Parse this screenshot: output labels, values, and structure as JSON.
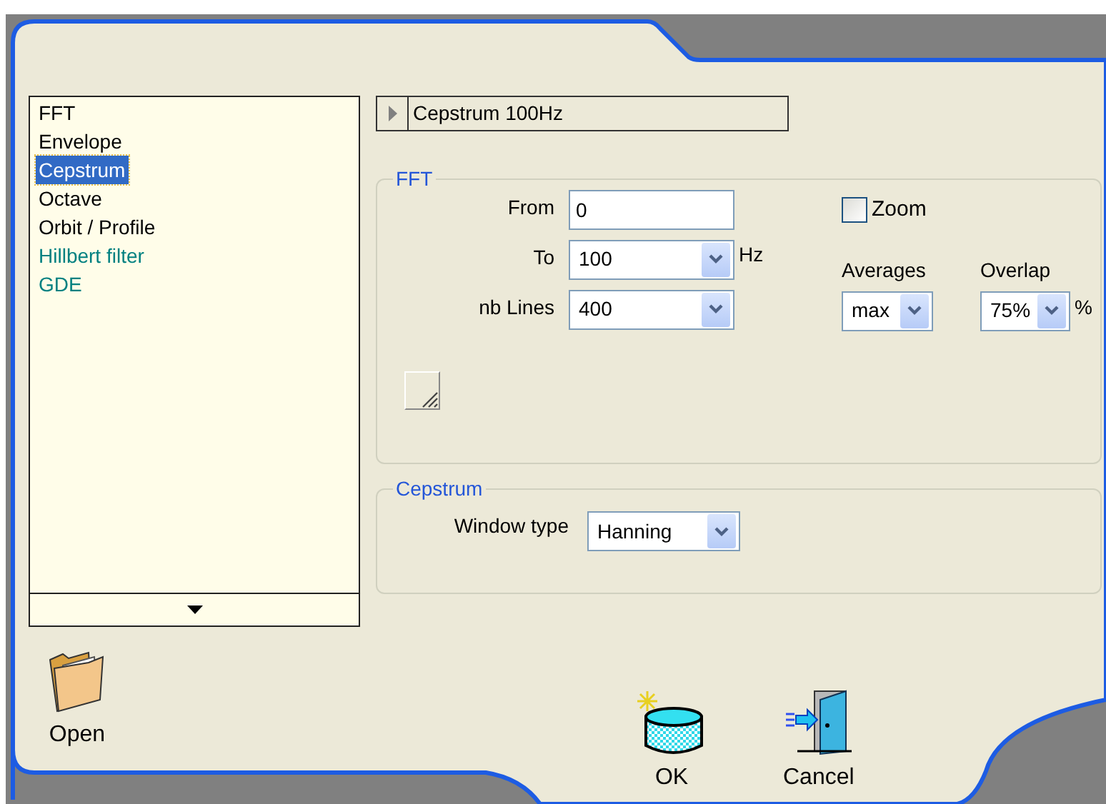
{
  "list": {
    "items": [
      {
        "label": "FFT",
        "selected": false,
        "color": "#000000"
      },
      {
        "label": "Envelope",
        "selected": false,
        "color": "#000000"
      },
      {
        "label": "Cepstrum",
        "selected": true
      },
      {
        "label": "Octave",
        "selected": false,
        "color": "#000000"
      },
      {
        "label": "Orbit / Profile",
        "selected": false,
        "color": "#000000"
      },
      {
        "label": "Hillbert filter",
        "selected": false,
        "color": "#008080"
      },
      {
        "label": "GDE",
        "selected": false,
        "color": "#008080"
      }
    ]
  },
  "header": {
    "title": "Cepstrum 100Hz",
    "expanded": false
  },
  "fft": {
    "title": "FFT",
    "fields": [
      {
        "label": "From",
        "kind": "text",
        "value": "0"
      },
      {
        "label": "To",
        "kind": "combo",
        "value": "100",
        "unit": "Hz"
      },
      {
        "label": "nb Lines",
        "kind": "combo",
        "value": "400"
      }
    ],
    "zoom": {
      "label": "Zoom",
      "checked": false
    },
    "averages": {
      "label": "Averages",
      "value": "max"
    },
    "overlap": {
      "label": "Overlap",
      "value": "75%",
      "unit": "%"
    }
  },
  "cepstrum": {
    "title": "Cepstrum",
    "window_type": {
      "label": "Window type",
      "value": "Hanning"
    }
  },
  "buttons": [
    {
      "label": "Open",
      "kind": "open"
    },
    {
      "label": "OK",
      "kind": "ok"
    },
    {
      "label": "Cancel",
      "kind": "cancel"
    }
  ]
}
